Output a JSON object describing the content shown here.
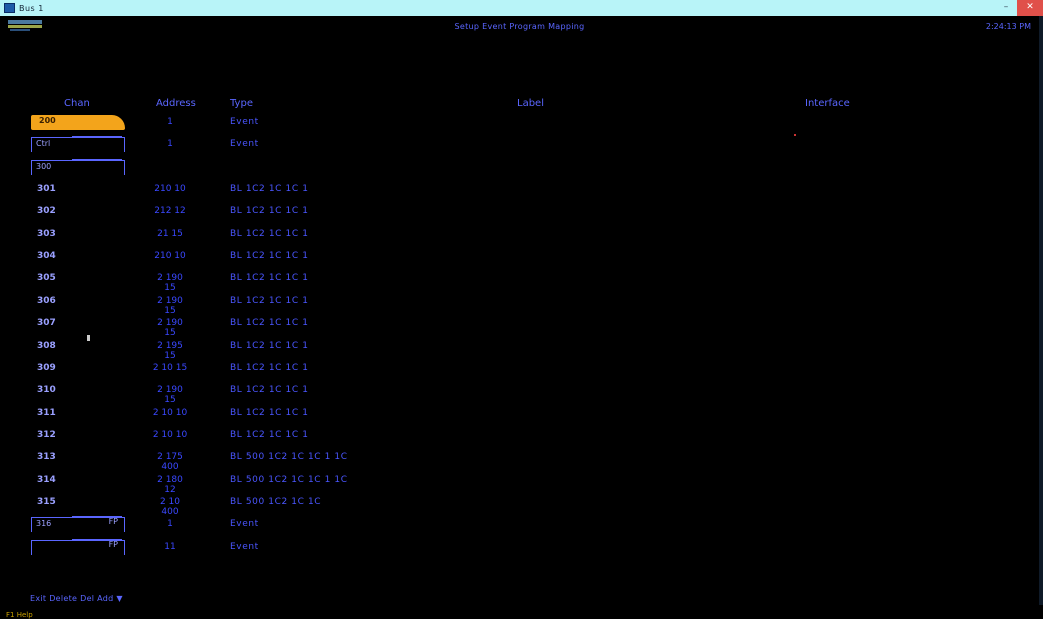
{
  "window": {
    "title": "Bus 1",
    "minimize_glyph": "–",
    "close_glyph": "✕"
  },
  "screen": {
    "title": "Setup Event Program Mapping",
    "clock": "2:24:13 PM",
    "logo_icon": "app-logo-icon"
  },
  "headers": {
    "channel": "Chan",
    "address": "Address",
    "type": "Type",
    "label": "Label",
    "interface": "Interface"
  },
  "rows": [
    {
      "chan": "200",
      "addr": "1",
      "type": "Event",
      "style": "selected"
    },
    {
      "chan": "Ctrl",
      "addr": "1",
      "type": "Event",
      "style": "box"
    },
    {
      "chan": "300",
      "addr": "",
      "type": "",
      "style": "box"
    },
    {
      "chan": "301",
      "addr": "210 10",
      "type": "BL 1C2 1C 1C 1",
      "style": "plain"
    },
    {
      "chan": "302",
      "addr": "212 12",
      "type": "BL 1C2 1C 1C 1",
      "style": "plain"
    },
    {
      "chan": "303",
      "addr": "21 15",
      "type": "BL 1C2 1C 1C 1",
      "style": "plain"
    },
    {
      "chan": "304",
      "addr": "210 10",
      "type": "BL 1C2 1C 1C 1",
      "style": "plain"
    },
    {
      "chan": "305",
      "addr": "2 190 15",
      "type": "BL 1C2 1C 1C 1",
      "style": "plain"
    },
    {
      "chan": "306",
      "addr": "2 190 15",
      "type": "BL 1C2 1C 1C 1",
      "style": "plain"
    },
    {
      "chan": "307",
      "addr": "2 190 15",
      "type": "BL 1C2 1C 1C 1",
      "style": "plain"
    },
    {
      "chan": "308",
      "addr": "2 195 15",
      "type": "BL 1C2 1C 1C 1",
      "style": "plain"
    },
    {
      "chan": "309",
      "addr": "2 10 15",
      "type": "BL 1C2 1C 1C 1",
      "style": "plain"
    },
    {
      "chan": "310",
      "addr": "2 190 15",
      "type": "BL 1C2 1C 1C 1",
      "style": "plain"
    },
    {
      "chan": "311",
      "addr": "2 10 10",
      "type": "BL 1C2 1C 1C 1",
      "style": "plain"
    },
    {
      "chan": "312",
      "addr": "2 10 10",
      "type": "BL 1C2 1C 1C 1",
      "style": "plain"
    },
    {
      "chan": "313",
      "addr": "2 175 400",
      "type": "BL 500 1C2 1C 1C 1 1C",
      "style": "plain"
    },
    {
      "chan": "314",
      "addr": "2 180 12",
      "type": "BL 500 1C2 1C 1C 1 1C",
      "style": "plain"
    },
    {
      "chan": "315",
      "addr": "2 10 400",
      "type": "BL 500 1C2 1C 1C",
      "style": "plain"
    },
    {
      "chan": "316",
      "addr": "1",
      "type": "Event",
      "style": "box",
      "flag": "FP"
    },
    {
      "chan": "",
      "addr": "11",
      "type": "Event",
      "style": "box",
      "flag": "FP"
    }
  ],
  "footer": {
    "text": "Exit  Delete  Del  Add ▼"
  },
  "status_tag": "F1 Help"
}
